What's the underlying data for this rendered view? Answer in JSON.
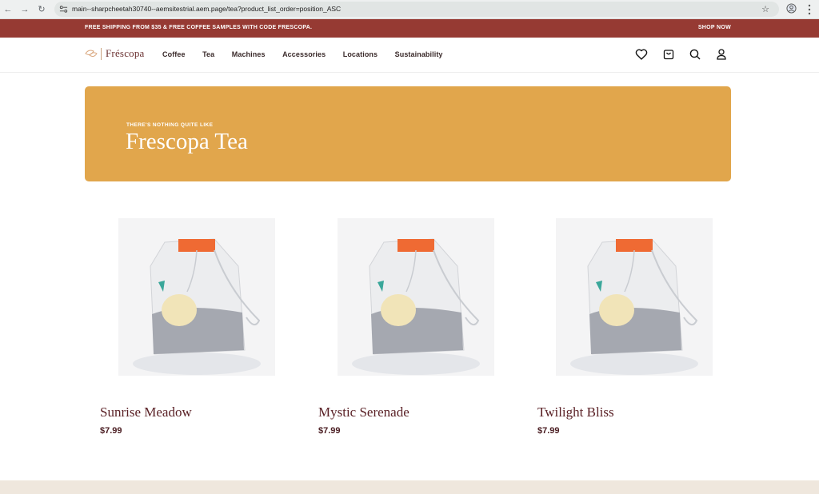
{
  "browser": {
    "url": "main--sharpcheetah30740--aemsitestrial.aem.page/tea?product_list_order=position_ASC",
    "back_icon": "arrow-left-icon",
    "forward_icon": "arrow-right-icon",
    "reload_icon": "reload-icon"
  },
  "promo": {
    "text": "FREE SHIPPING FROM $35 & FREE COFFEE SAMPLES WITH CODE FRESCOPA.",
    "link": "SHOP NOW"
  },
  "header": {
    "logo_text": "Fréscopa",
    "nav": [
      "Coffee",
      "Tea",
      "Machines",
      "Accessories",
      "Locations",
      "Sustainability"
    ]
  },
  "hero": {
    "kicker": "THERE'S NOTHING QUITE LIKE",
    "title": "Frescopa Tea"
  },
  "products": [
    {
      "name": "Sunrise Meadow",
      "price": "$7.99"
    },
    {
      "name": "Mystic Serenade",
      "price": "$7.99"
    },
    {
      "name": "Twilight Bliss",
      "price": "$7.99"
    }
  ],
  "colors": {
    "promo_bg": "#963a33",
    "hero_bg": "#e1a64c",
    "product_text": "#5a2126",
    "footer_bg": "#efe7dd"
  }
}
